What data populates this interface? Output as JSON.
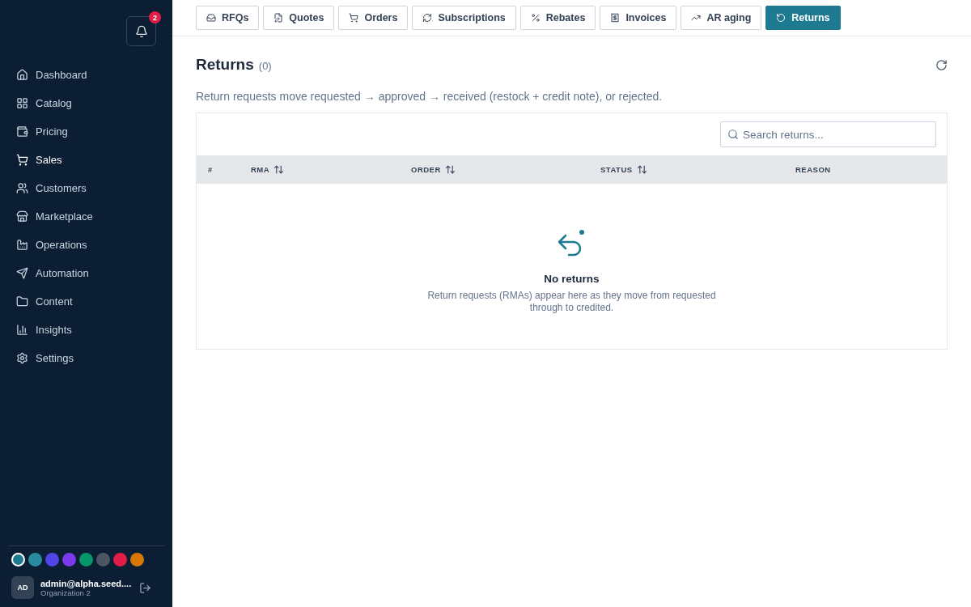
{
  "notifications": {
    "count": "2"
  },
  "sidebar": {
    "items": [
      {
        "kind": "home",
        "label": "Dashboard",
        "selected": false
      },
      {
        "kind": "grid",
        "label": "Catalog",
        "selected": false
      },
      {
        "kind": "wallet",
        "label": "Pricing",
        "selected": false
      },
      {
        "kind": "cart",
        "label": "Sales",
        "selected": true
      },
      {
        "kind": "users",
        "label": "Customers",
        "selected": false
      },
      {
        "kind": "store",
        "label": "Marketplace",
        "selected": false
      },
      {
        "kind": "factory",
        "label": "Operations",
        "selected": false
      },
      {
        "kind": "send",
        "label": "Automation",
        "selected": false
      },
      {
        "kind": "folder",
        "label": "Content",
        "selected": false
      },
      {
        "kind": "chart",
        "label": "Insights",
        "selected": false
      },
      {
        "kind": "gear",
        "label": "Settings",
        "selected": false
      }
    ]
  },
  "themes": [
    {
      "color": "#1e7a90",
      "selected": true
    },
    {
      "color": "#2a8aa0",
      "selected": false
    },
    {
      "color": "#4f46e5",
      "selected": false
    },
    {
      "color": "#7c3aed",
      "selected": false
    },
    {
      "color": "#059669",
      "selected": false
    },
    {
      "color": "#4b5563",
      "selected": false
    },
    {
      "color": "#e11d48",
      "selected": false
    },
    {
      "color": "#d97706",
      "selected": false
    }
  ],
  "user": {
    "initials": "AD",
    "email": "admin@alpha.seed....",
    "org": "Organization 2"
  },
  "tabs": [
    {
      "kind": "inbox",
      "label": "RFQs",
      "selected": false
    },
    {
      "kind": "quote",
      "label": "Quotes",
      "selected": false
    },
    {
      "kind": "cart",
      "label": "Orders",
      "selected": false
    },
    {
      "kind": "refresh",
      "label": "Subscriptions",
      "selected": false
    },
    {
      "kind": "percent",
      "label": "Rebates",
      "selected": false
    },
    {
      "kind": "receipt",
      "label": "Invoices",
      "selected": false
    },
    {
      "kind": "trend",
      "label": "AR aging",
      "selected": false
    },
    {
      "kind": "undo",
      "label": "Returns",
      "selected": true
    }
  ],
  "page": {
    "title": "Returns",
    "count": "(0)",
    "description": "Return requests move requested → approved → received (restock + credit note), or rejected."
  },
  "search": {
    "placeholder": "Search returns..."
  },
  "table": {
    "columns": [
      {
        "label": "#",
        "sortable": false
      },
      {
        "label": "RMA",
        "sortable": true
      },
      {
        "label": "ORDER",
        "sortable": true
      },
      {
        "label": "STATUS",
        "sortable": true
      },
      {
        "label": "REASON",
        "sortable": false
      }
    ]
  },
  "empty": {
    "title": "No returns",
    "text": "Return requests (RMAs) appear here as they move from requested through to credited."
  }
}
